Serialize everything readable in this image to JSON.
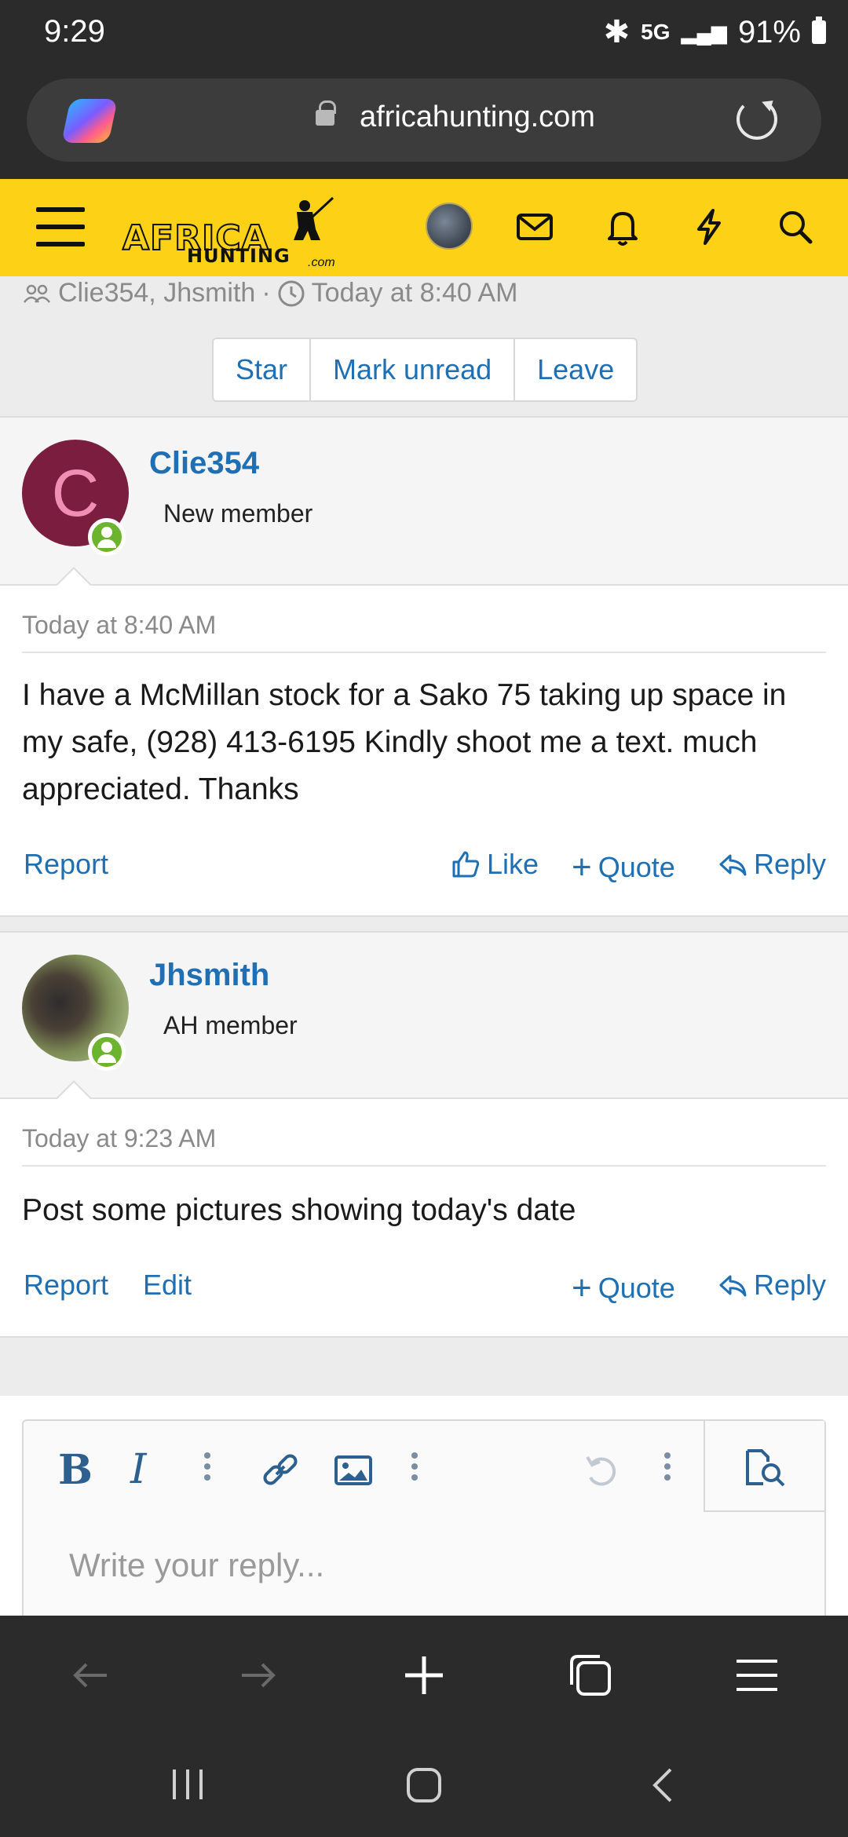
{
  "status_bar": {
    "time": "9:29",
    "network": "5G",
    "battery": "91%"
  },
  "browser": {
    "url": "africahunting.com"
  },
  "site": {
    "logo_line1": "AFRICA",
    "logo_line2": "HUNTING",
    "logo_line3": ".com",
    "brand_color": "#fcd116"
  },
  "conversation": {
    "participants": "Clie354, Jhsmith",
    "separator": "·",
    "started": "Today at 8:40 AM",
    "buttons": [
      "Star",
      "Mark unread",
      "Leave"
    ]
  },
  "posts": [
    {
      "author": "Clie354",
      "initial": "C",
      "role": "New member",
      "date": "Today at 8:40 AM",
      "text": "I have a McMillan stock for a Sako 75 taking up space in my safe, (928) 413-6195 Kindly shoot me a text. much appreciated. Thanks",
      "actions": {
        "report": "Report",
        "like": "Like",
        "quote": "Quote",
        "reply": "Reply"
      }
    },
    {
      "author": "Jhsmith",
      "role": "AH member",
      "date": "Today at 9:23 AM",
      "text": "Post some pictures showing today's date",
      "actions": {
        "report": "Report",
        "edit": "Edit",
        "quote": "Quote",
        "reply": "Reply"
      }
    }
  ],
  "editor": {
    "placeholder": "Write your reply..."
  },
  "colors": {
    "link": "#1e6fb3",
    "online": "#6cb32e",
    "avatar_c_bg": "#7a1d3e"
  }
}
